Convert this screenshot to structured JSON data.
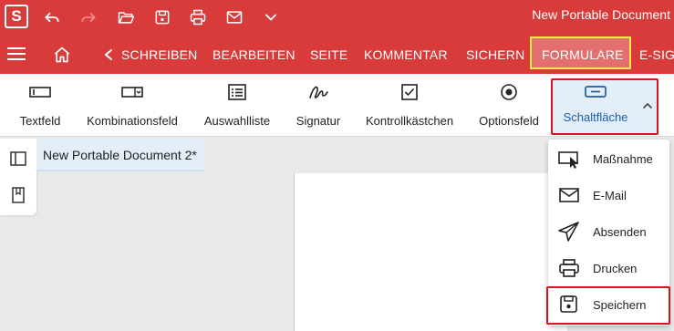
{
  "titlebar": {
    "logo": "S",
    "title": "New Portable Document",
    "icons": [
      "undo-icon",
      "redo-icon",
      "open-folder-icon",
      "save-icon",
      "print-icon",
      "email-icon",
      "chevron-down-icon"
    ]
  },
  "ribbon": {
    "tabs": [
      {
        "label": "SCHREIBEN"
      },
      {
        "label": "BEARBEITEN"
      },
      {
        "label": "SEITE"
      },
      {
        "label": "KOMMENTAR"
      },
      {
        "label": "SICHERN"
      },
      {
        "label": "FORMULARE",
        "active": true
      },
      {
        "label": "E-SIGN"
      }
    ]
  },
  "toolbar": {
    "tools": [
      {
        "label": "Textfeld",
        "icon": "textfield-icon"
      },
      {
        "label": "Kombinationsfeld",
        "icon": "combobox-icon"
      },
      {
        "label": "Auswahlliste",
        "icon": "listbox-icon"
      },
      {
        "label": "Signatur",
        "icon": "signature-icon"
      },
      {
        "label": "Kontrollkästchen",
        "icon": "checkbox-icon"
      },
      {
        "label": "Optionsfeld",
        "icon": "radio-icon"
      },
      {
        "label": "Schaltfläche",
        "icon": "button-icon",
        "active": true
      }
    ]
  },
  "document": {
    "tab_label": "New Portable Document 2*"
  },
  "dropdown": {
    "items": [
      {
        "label": "Maßnahme",
        "icon": "action-cursor-icon"
      },
      {
        "label": "E-Mail",
        "icon": "email-icon"
      },
      {
        "label": "Absenden",
        "icon": "send-icon"
      },
      {
        "label": "Drucken",
        "icon": "print-icon"
      },
      {
        "label": "Speichern",
        "icon": "save-icon",
        "highlighted": true
      }
    ]
  },
  "colors": {
    "brand_red": "#d93a3a",
    "active_tab_bg": "#e36f6f",
    "highlight_yellow": "#f5e74c",
    "callout_red": "#d8141a",
    "active_blue": "#1a5ea6",
    "active_bg": "#e4eef8"
  }
}
